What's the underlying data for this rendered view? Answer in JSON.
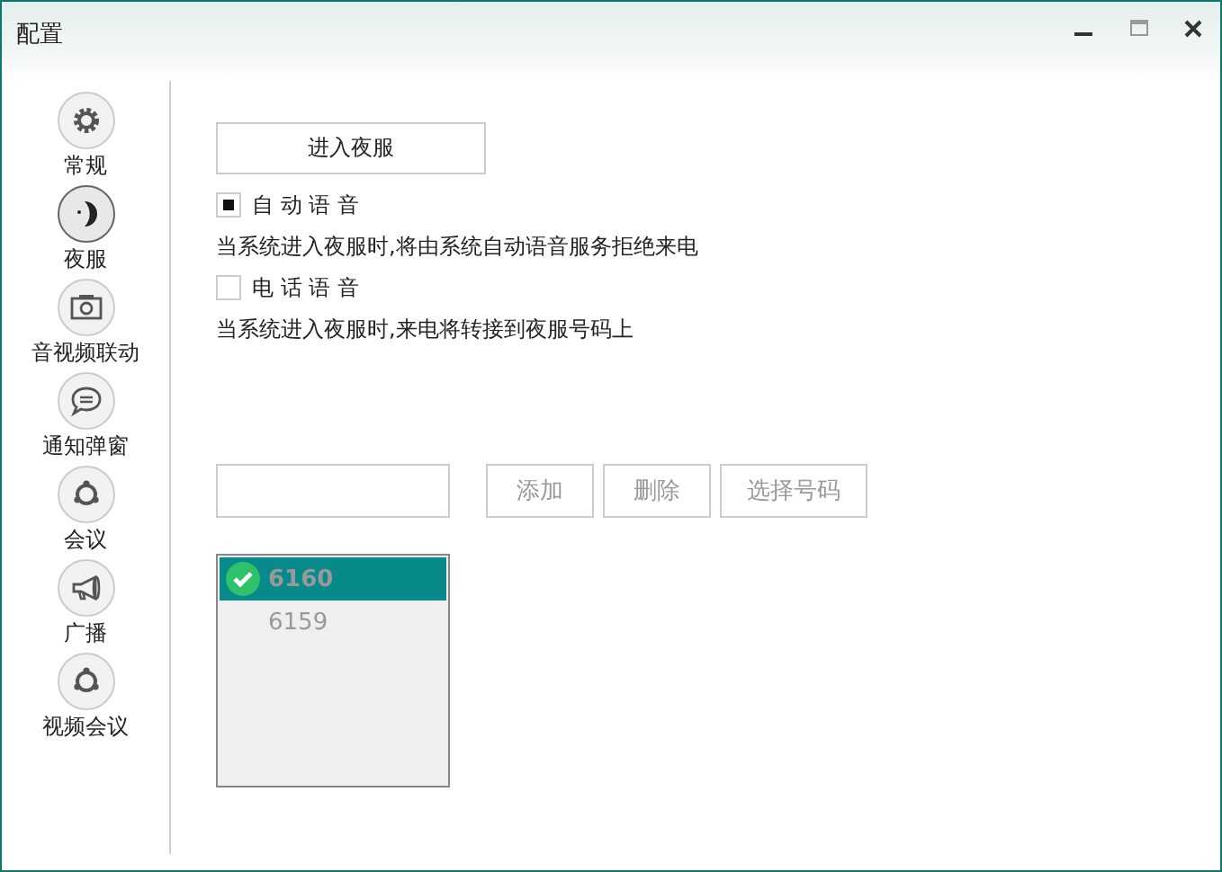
{
  "window": {
    "title": "配置"
  },
  "sidebar": {
    "items": [
      {
        "label": "常规",
        "selected": false
      },
      {
        "label": "夜服",
        "selected": true
      },
      {
        "label": "音视频联动",
        "selected": false
      },
      {
        "label": "通知弹窗",
        "selected": false
      },
      {
        "label": "会议",
        "selected": false
      },
      {
        "label": "广播",
        "selected": false
      },
      {
        "label": "视频会议",
        "selected": false
      }
    ]
  },
  "enter_button": "进入夜服",
  "options": [
    {
      "label": "自 动 语 音",
      "checked": true,
      "description": "当系统进入夜服时,将由系统自动语音服务拒绝来电"
    },
    {
      "label": "电 话 语 音",
      "checked": false,
      "description": "当系统进入夜服时,来电将转接到夜服号码上"
    }
  ],
  "buttons": [
    "添加",
    "删除",
    "选择号码"
  ],
  "numbers": [
    {
      "label": "6160",
      "selected": true
    },
    {
      "label": "6159",
      "selected": false
    }
  ]
}
